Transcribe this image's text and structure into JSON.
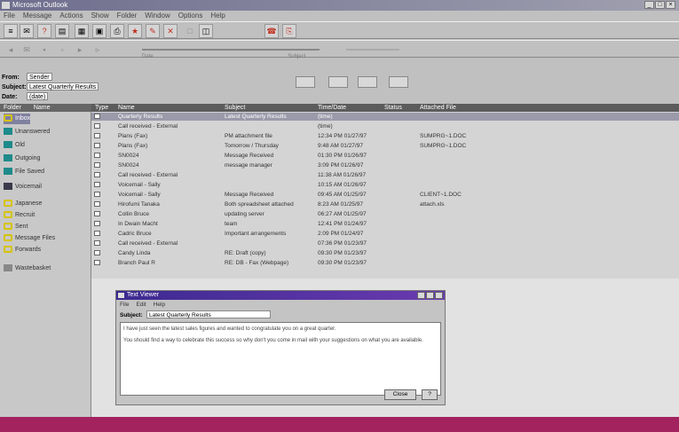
{
  "window": {
    "title": "Microsoft Outlook"
  },
  "menu": [
    "File",
    "Message",
    "Actions",
    "Show",
    "Folder",
    "Window",
    "Options",
    "Help"
  ],
  "toolbar1": [
    "≡",
    "✉",
    "?",
    "▤",
    "▦",
    "▣",
    "⎙",
    "★",
    "✎",
    "✕",
    "□",
    "◫"
  ],
  "toolbar2": [
    "◂",
    "✉",
    "▪",
    "▫",
    "▸",
    "▹"
  ],
  "header_labels": [
    "Date",
    "Subject"
  ],
  "fields": {
    "from_label": "From:",
    "from_value": "Sender",
    "subject_label": "Subject:",
    "subject_value": "Latest Quarterly Results",
    "date_label": "Date:",
    "date_value": "(date)"
  },
  "folders": {
    "header": [
      "Folder",
      "Name"
    ],
    "items": [
      {
        "label": "Inbox",
        "icon": "inbox-icon",
        "color": "yellow",
        "selected": true
      },
      {
        "label": "Unanswered",
        "icon": "folder-icon",
        "color": "teal"
      },
      {
        "label": "Old",
        "icon": "folder-icon",
        "color": "teal"
      },
      {
        "label": "Outgoing",
        "icon": "folder-icon",
        "color": "teal"
      },
      {
        "label": "File Saved",
        "icon": "folder-icon",
        "color": "teal"
      },
      {
        "label": "Voicemail",
        "icon": "voicemail-icon",
        "color": "dark"
      },
      {
        "label": "Japanese",
        "icon": "folder-icon",
        "color": "yellow"
      },
      {
        "label": "Recruit",
        "icon": "folder-icon",
        "color": "yellow"
      },
      {
        "label": "Sent",
        "icon": "folder-icon",
        "color": "yellow"
      },
      {
        "label": "Message Files",
        "icon": "folder-icon",
        "color": "yellow"
      },
      {
        "label": "Forwards",
        "icon": "folder-icon",
        "color": "yellow"
      },
      {
        "label": "Wastebasket",
        "icon": "trash-icon",
        "color": "grey"
      }
    ]
  },
  "list": {
    "columns": [
      "Type",
      "Name",
      "Subject",
      "Time/Date",
      "Status",
      "Attached File"
    ],
    "rows": [
      {
        "name": "Quarterly Results",
        "subject": "Latest Quarterly Results",
        "time": "(time)",
        "status": "",
        "file": ""
      },
      {
        "name": "Call received - External",
        "subject": "",
        "time": "(time)",
        "status": "",
        "file": ""
      },
      {
        "name": "Plans (Fax)",
        "subject": "PM attachment file",
        "time": "12:34 PM 01/27/97",
        "status": "",
        "file": "SUMPRG~1.DOC"
      },
      {
        "name": "Plans (Fax)",
        "subject": "Tomorrow / Thursday",
        "time": "9:48 AM 01/27/97",
        "status": "",
        "file": "SUMPRG~1.DOC"
      },
      {
        "name": "SN0024",
        "subject": "Message Received",
        "time": "01:30 PM 01/26/97",
        "status": "",
        "file": ""
      },
      {
        "name": "SN0024",
        "subject": "message manager",
        "time": "3:09 PM 01/26/97",
        "status": "",
        "file": ""
      },
      {
        "name": "Call received - External",
        "subject": "",
        "time": "11:38 AM 01/26/97",
        "status": "",
        "file": ""
      },
      {
        "name": "Voicemail - Sally",
        "subject": "",
        "time": "10:15 AM 01/26/97",
        "status": "",
        "file": ""
      },
      {
        "name": "Voicemail - Sally",
        "subject": "Message Received",
        "time": "09:45 AM 01/25/97",
        "status": "",
        "file": "CLIENT~1.DOC"
      },
      {
        "name": "Hirofumi Tanaka",
        "subject": "Both spreadsheet attached",
        "time": "8:23 AM 01/25/97",
        "status": "",
        "file": "attach.xls"
      },
      {
        "name": "Collin Bruce",
        "subject": "updating server",
        "time": "06:27 AM 01/25/97",
        "status": "",
        "file": ""
      },
      {
        "name": "In Dwain Macht",
        "subject": "team",
        "time": "12:41 PM 01/24/97",
        "status": "",
        "file": ""
      },
      {
        "name": "Cadric Bruce",
        "subject": "Important arrangements",
        "time": "2:09 PM 01/24/97",
        "status": "",
        "file": ""
      },
      {
        "name": "Call received - External",
        "subject": "",
        "time": "07:36 PM 01/23/97",
        "status": "",
        "file": ""
      },
      {
        "name": "Candy Linda",
        "subject": "RE: Draft (copy)",
        "time": "09:30 PM 01/23/97",
        "status": "",
        "file": ""
      },
      {
        "name": "Branch Paul R",
        "subject": "RE: DB - Fax (Webpage)",
        "time": "09:30 PM 01/23/97",
        "status": "",
        "file": ""
      }
    ]
  },
  "dialog": {
    "title": "Text Viewer",
    "menu": [
      "File",
      "Edit",
      "Help"
    ],
    "subject_label": "Subject:",
    "subject_value": "Latest Quarterly Results",
    "body_1": "I have just seen the latest sales figures and wanted to congratulate you on a great quarter.",
    "body_2": "You should find a way to celebrate this success so why don't you come in mail with your suggestions on what you are available.",
    "close_label": "Close",
    "help_label": "?"
  }
}
